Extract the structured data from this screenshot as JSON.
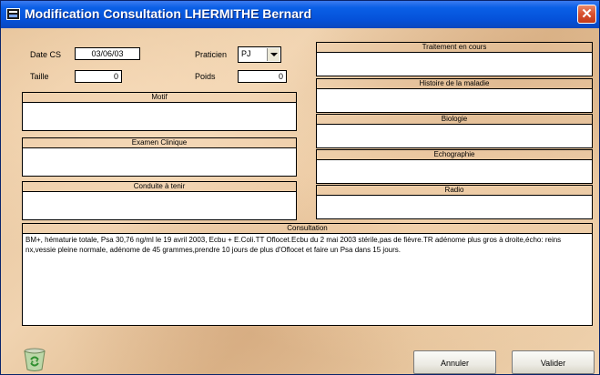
{
  "window": {
    "title": "Modification Consultation LHERMITHE Bernard",
    "close_label": "✕"
  },
  "form": {
    "date_label": "Date CS",
    "date_value": "03/06/03",
    "praticien_label": "Praticien",
    "praticien_value": "PJ",
    "taille_label": "Taille",
    "taille_value": "0",
    "poids_label": "Poids",
    "poids_value": "0"
  },
  "sections": {
    "motif": {
      "title": "Motif",
      "content": ""
    },
    "examen": {
      "title": "Examen Clinique",
      "content": ""
    },
    "conduite": {
      "title": "Conduite à tenir",
      "content": ""
    },
    "traitement": {
      "title": "Traitement en cours",
      "content": ""
    },
    "histoire": {
      "title": "Histoire de la maladie",
      "content": ""
    },
    "biologie": {
      "title": "Biologie",
      "content": ""
    },
    "echographie": {
      "title": "Echographie",
      "content": ""
    },
    "radio": {
      "title": "Radio",
      "content": ""
    },
    "consultation": {
      "title": "Consultation",
      "content": "BM+, hématurie totale, Psa 30,76 ng/ml le 19 avril 2003, Ecbu + E.Coli.TT Oflocet.Ecbu du 2 mai 2003 stérile,pas de fièvre.TR adénome plus gros à droite,écho: reins nx,vessie pleine normale, adénome de 45 grammes,prendre 10 jours de plus d'Oflocet et faire un Psa dans 15 jours."
    }
  },
  "buttons": {
    "annuler": "Annuler",
    "valider": "Valider"
  },
  "icons": {
    "trash": "recycle-bin-icon",
    "app": "app-icon"
  },
  "colors": {
    "titlebar": "#0551d9",
    "background": "#e8c9a2",
    "close": "#d8502e"
  }
}
